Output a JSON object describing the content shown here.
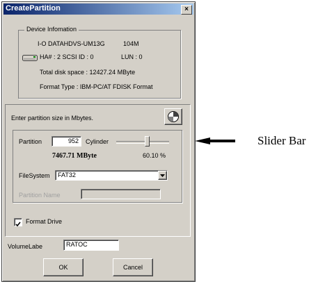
{
  "window": {
    "title": "CreatePartition",
    "close_glyph": "×"
  },
  "device_info": {
    "group_label": "Device Infomation",
    "model": "I-O DATAHDVS-UM13G",
    "size": "104M",
    "ha": "HA# : 2  SCSI ID : 0",
    "lun": "LUN : 0",
    "total_space": "Total disk space : 12427.24 MByte",
    "format_type": "Format Type : IBM-PC/AT FDISK Format",
    "icon": "hard-drive-icon"
  },
  "partition_section": {
    "instruction": "Enter partition size in Mbytes.",
    "pie_icon": "pie-chart-icon",
    "partition_label": "Partition",
    "partition_value": "952",
    "cylinder_label": "Cylinder",
    "mbyte_value": "7467.71 MByte",
    "percent_value": "60.10 %",
    "slider_level": 0.6,
    "filesystem_label": "FileSystem",
    "filesystem_value": "FAT32",
    "partition_name_label": "Partition Name",
    "partition_name_value": ""
  },
  "format_drive": {
    "label": "Format Drive",
    "checked": true
  },
  "volume_label": {
    "label": "VolumeLabe",
    "value": "RATOC"
  },
  "buttons": {
    "ok": "OK",
    "cancel": "Cancel"
  },
  "annotation": {
    "text": "Slider Bar"
  },
  "colors": {
    "face": "#d4d0c8",
    "title_start": "#0a246a",
    "title_end": "#a6caf0"
  }
}
